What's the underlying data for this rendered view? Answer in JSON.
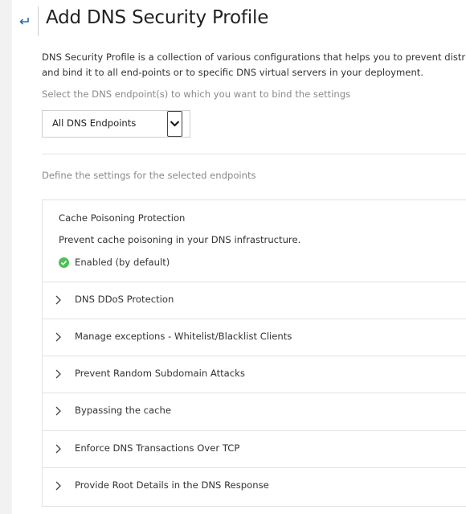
{
  "header": {
    "back_glyph": "↵",
    "title": "Add DNS Security Profile"
  },
  "description": {
    "line1": "DNS Security Profile is a collection of various configurations that helps you to prevent distributed d",
    "line2": "and bind it to all end-points or to specific DNS virtual servers in your deployment."
  },
  "endpoint": {
    "label": "Select the DNS endpoint(s) to which you want to bind the settings",
    "selected": "All DNS Endpoints"
  },
  "settings": {
    "label": "Define the settings for the selected endpoints",
    "cache_poisoning": {
      "title": "Cache Poisoning Protection",
      "description": "Prevent cache poisoning in your DNS infrastructure.",
      "status": "Enabled (by default)",
      "status_color": "#4fbf56"
    },
    "items": [
      {
        "label": "DNS DDoS Protection"
      },
      {
        "label": "Manage exceptions - Whitelist/Blacklist Clients"
      },
      {
        "label": "Prevent Random Subdomain Attacks"
      },
      {
        "label": "Bypassing the cache"
      },
      {
        "label": "Enforce DNS Transactions Over TCP"
      },
      {
        "label": "Provide Root Details in the DNS Response"
      }
    ]
  },
  "colors": {
    "accent": "#2b6bb5",
    "success": "#4fbf56"
  }
}
